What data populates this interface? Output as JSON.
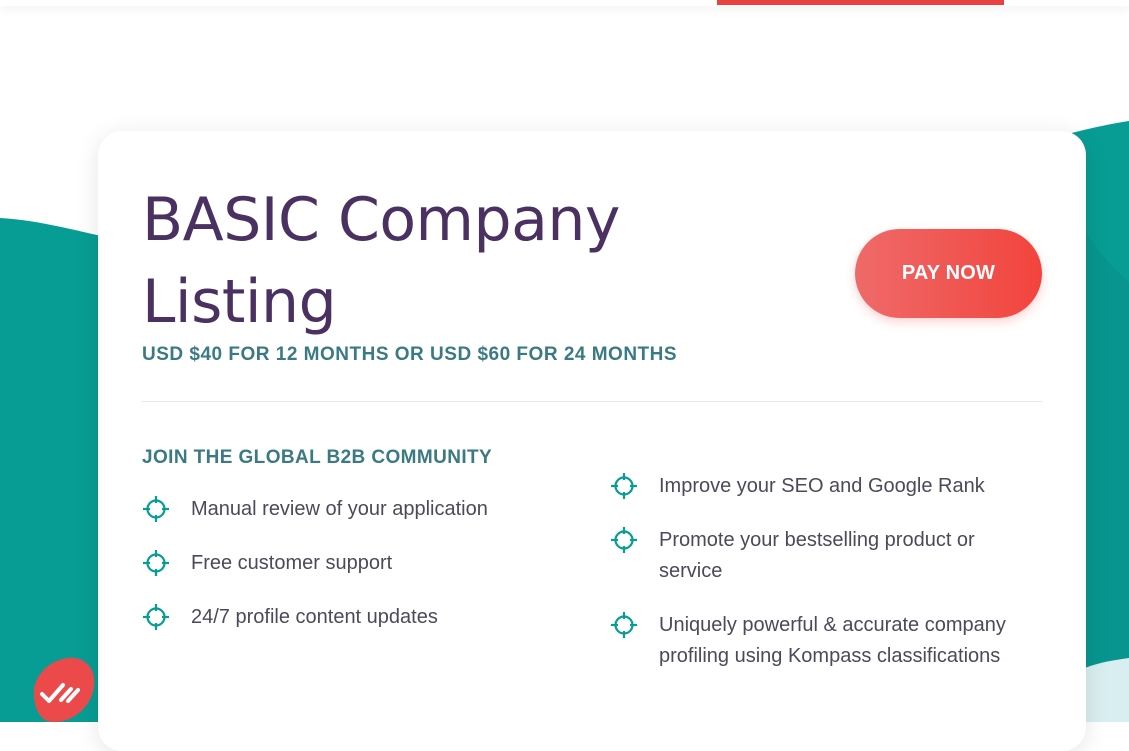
{
  "card": {
    "title": "BASIC Company Listing",
    "subtitle": "USD $40 FOR 12 MONTHS OR USD $60 FOR 24 MONTHS",
    "pay_button": "PAY NOW",
    "section_heading": "JOIN THE GLOBAL B2B COMMUNITY",
    "features_left": [
      {
        "text": "Manual review of your application",
        "icon": "crosshair-icon"
      },
      {
        "text": "Free customer support",
        "icon": "crosshair-icon"
      },
      {
        "text": "24/7 profile content updates",
        "icon": "crosshair-icon"
      }
    ],
    "features_right": [
      {
        "text": "Improve your SEO and Google Rank",
        "icon": "crosshair-icon"
      },
      {
        "text": "Promote your bestselling product or service",
        "icon": "crosshair-icon"
      },
      {
        "text": "Uniquely powerful & accurate company profiling using Kompass classifications",
        "icon": "crosshair-icon"
      }
    ]
  },
  "colors": {
    "teal": "#079d94",
    "title_purple": "#4a3161",
    "heading_teal": "#3b7a83",
    "pay_button": "#f2443c",
    "chat_badge": "#ec4a4a",
    "top_accent": "#e8413f"
  },
  "chat_widget": {
    "icon": "chat-checkmarks-icon"
  }
}
